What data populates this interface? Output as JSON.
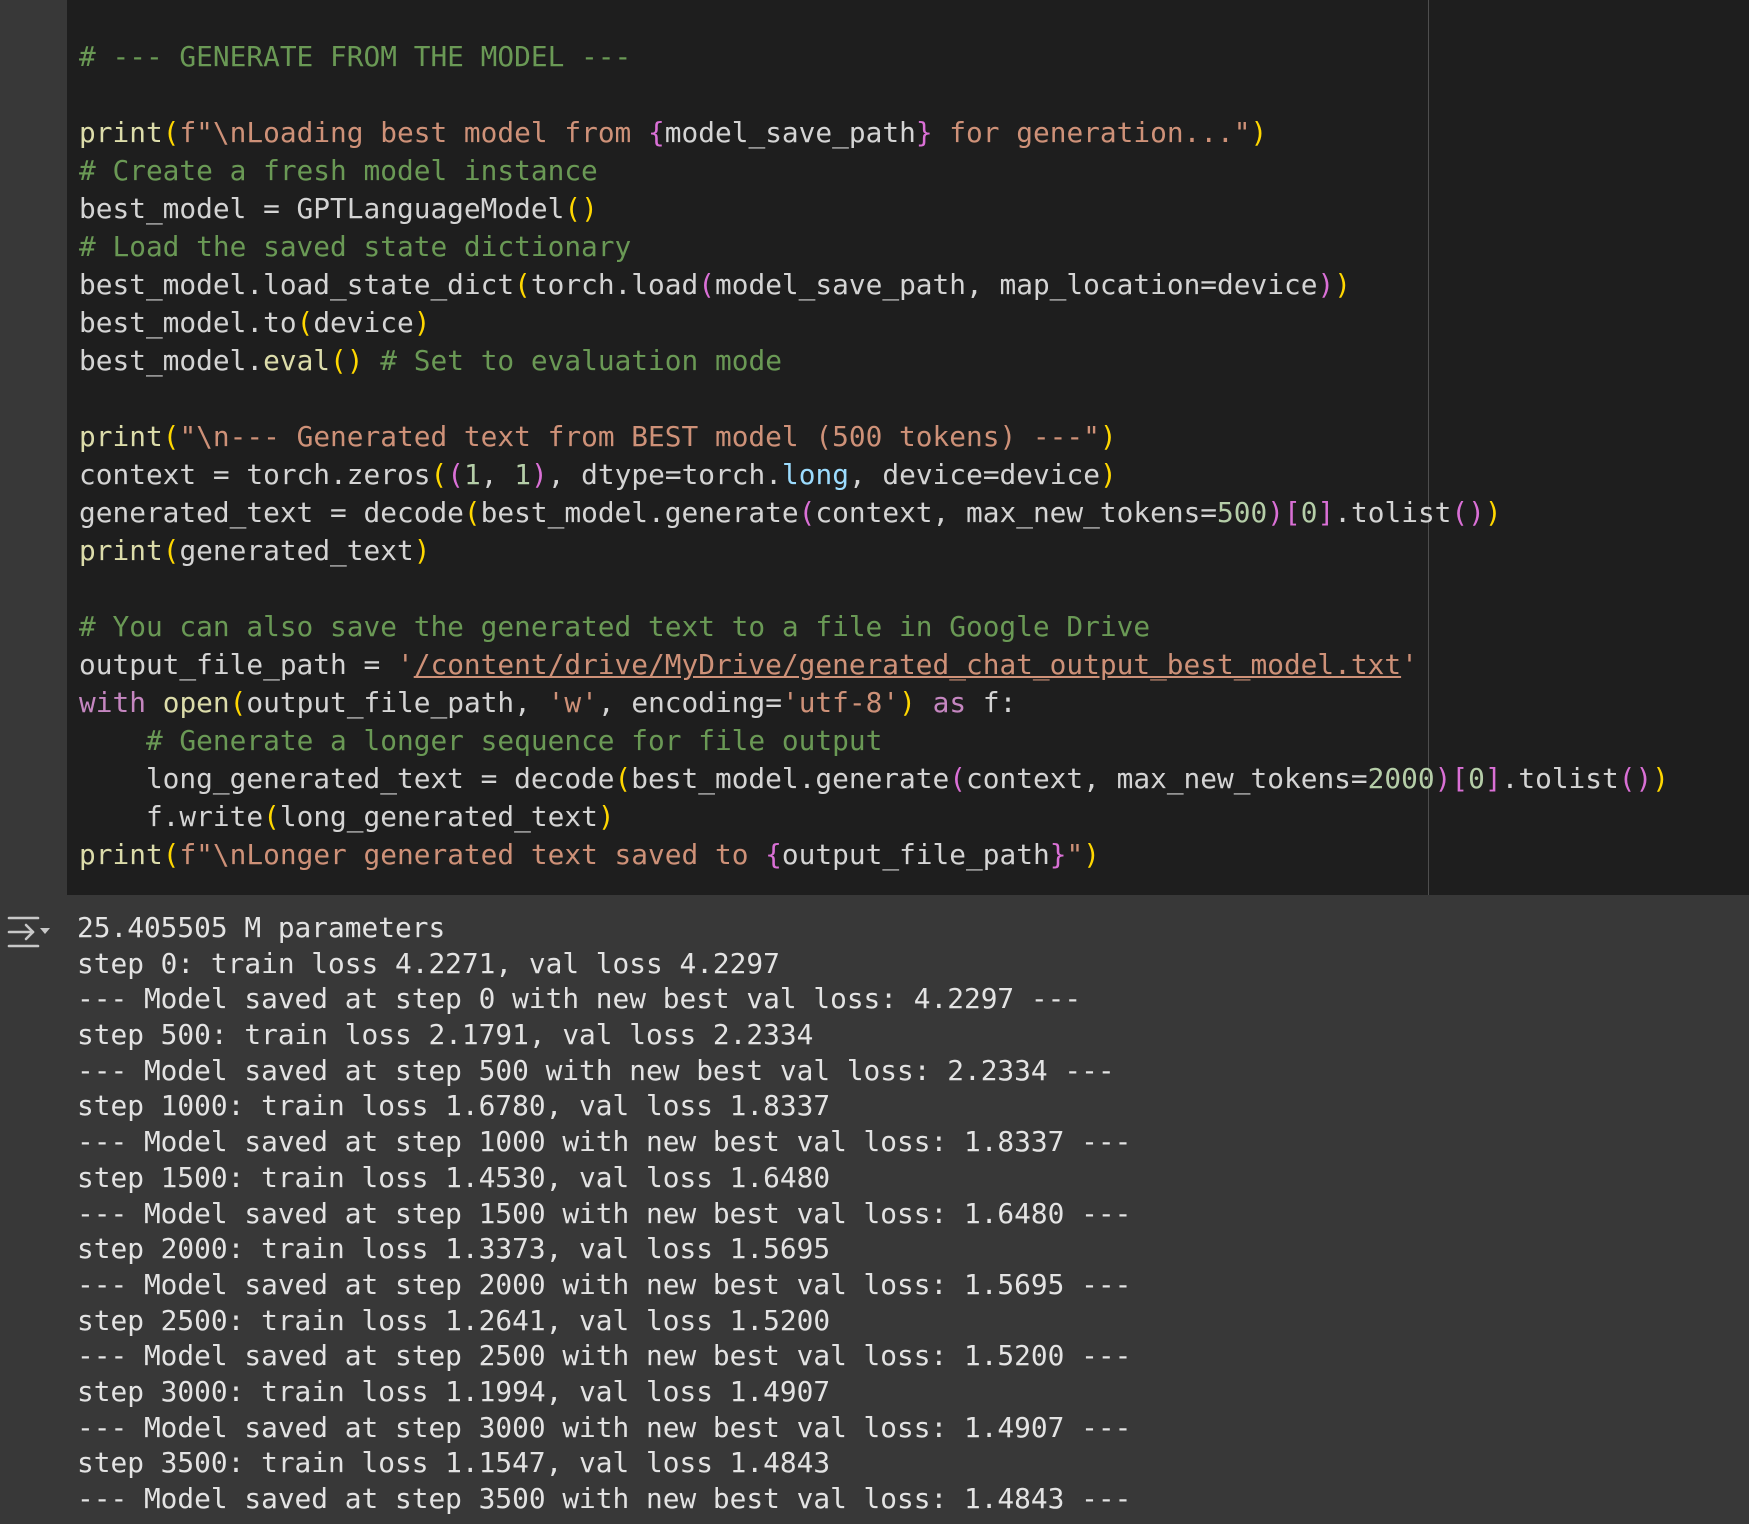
{
  "code_cell": {
    "lines": [
      [
        {
          "t": "# --- GENERATE FROM THE MODEL ---",
          "c": "cm"
        }
      ],
      [],
      [
        {
          "t": "print",
          "c": "fn"
        },
        {
          "t": "(",
          "c": "p1"
        },
        {
          "t": "f\"\\nLoading best model from ",
          "c": "st"
        },
        {
          "t": "{",
          "c": "p2"
        },
        {
          "t": "model_save_path"
        },
        {
          "t": "}",
          "c": "p2"
        },
        {
          "t": " for generation...\"",
          "c": "st"
        },
        {
          "t": ")",
          "c": "p1"
        }
      ],
      [
        {
          "t": "# Create a fresh model instance",
          "c": "cm"
        }
      ],
      [
        {
          "t": "best_model = GPTLanguageModel"
        },
        {
          "t": "()",
          "c": "p1"
        }
      ],
      [
        {
          "t": "# Load the saved state dictionary",
          "c": "cm"
        }
      ],
      [
        {
          "t": "best_model.load_state_dict"
        },
        {
          "t": "(",
          "c": "p1"
        },
        {
          "t": "torch.load"
        },
        {
          "t": "(",
          "c": "p2"
        },
        {
          "t": "model_save_path, map_location=device"
        },
        {
          "t": ")",
          "c": "p2"
        },
        {
          "t": ")",
          "c": "p1"
        }
      ],
      [
        {
          "t": "best_model.to"
        },
        {
          "t": "(",
          "c": "p1"
        },
        {
          "t": "device"
        },
        {
          "t": ")",
          "c": "p1"
        }
      ],
      [
        {
          "t": "best_model."
        },
        {
          "t": "eval",
          "c": "fn"
        },
        {
          "t": "()",
          "c": "p1"
        },
        {
          "t": " "
        },
        {
          "t": "# Set to evaluation mode",
          "c": "cm"
        }
      ],
      [],
      [
        {
          "t": "print",
          "c": "fn"
        },
        {
          "t": "(",
          "c": "p1"
        },
        {
          "t": "\"\\n--- Generated text from BEST model (500 tokens) ---\"",
          "c": "st"
        },
        {
          "t": ")",
          "c": "p1"
        }
      ],
      [
        {
          "t": "context = torch.zeros"
        },
        {
          "t": "(",
          "c": "p1"
        },
        {
          "t": "(",
          "c": "p2"
        },
        {
          "t": "1",
          "c": "nu"
        },
        {
          "t": ", "
        },
        {
          "t": "1",
          "c": "nu"
        },
        {
          "t": ")",
          "c": "p2"
        },
        {
          "t": ", dtype=torch."
        },
        {
          "t": "long",
          "c": "ty"
        },
        {
          "t": ", device=device"
        },
        {
          "t": ")",
          "c": "p1"
        }
      ],
      [
        {
          "t": "generated_text = decode"
        },
        {
          "t": "(",
          "c": "p1"
        },
        {
          "t": "best_model.generate"
        },
        {
          "t": "(",
          "c": "p2"
        },
        {
          "t": "context, max_new_tokens="
        },
        {
          "t": "500",
          "c": "nu"
        },
        {
          "t": ")",
          "c": "p2"
        },
        {
          "t": "[",
          "c": "p2"
        },
        {
          "t": "0",
          "c": "nu"
        },
        {
          "t": "]",
          "c": "p2"
        },
        {
          "t": ".tolist"
        },
        {
          "t": "()",
          "c": "p2"
        },
        {
          "t": ")",
          "c": "p1"
        }
      ],
      [
        {
          "t": "print",
          "c": "fn"
        },
        {
          "t": "(",
          "c": "p1"
        },
        {
          "t": "generated_text"
        },
        {
          "t": ")",
          "c": "p1"
        }
      ],
      [],
      [
        {
          "t": "# You can also save the generated text to a file in Google Drive",
          "c": "cm"
        }
      ],
      [
        {
          "t": "output_file_path = "
        },
        {
          "t": "'",
          "c": "st"
        },
        {
          "t": "/content/drive/MyDrive/generated_chat_output_best_model.txt",
          "c": "st ul"
        },
        {
          "t": "'",
          "c": "st"
        }
      ],
      [
        {
          "t": "with",
          "c": "kw"
        },
        {
          "t": " "
        },
        {
          "t": "open",
          "c": "fn"
        },
        {
          "t": "(",
          "c": "p1"
        },
        {
          "t": "output_file_path, "
        },
        {
          "t": "'w'",
          "c": "st"
        },
        {
          "t": ", encoding="
        },
        {
          "t": "'utf-8'",
          "c": "st"
        },
        {
          "t": ")",
          "c": "p1"
        },
        {
          "t": " "
        },
        {
          "t": "as",
          "c": "kw"
        },
        {
          "t": " f:"
        }
      ],
      [
        {
          "t": "    "
        },
        {
          "t": "# Generate a longer sequence for file output",
          "c": "cm"
        }
      ],
      [
        {
          "t": "    long_generated_text = decode"
        },
        {
          "t": "(",
          "c": "p1"
        },
        {
          "t": "best_model.generate"
        },
        {
          "t": "(",
          "c": "p2"
        },
        {
          "t": "context, max_new_tokens="
        },
        {
          "t": "2000",
          "c": "nu"
        },
        {
          "t": ")",
          "c": "p2"
        },
        {
          "t": "[",
          "c": "p2"
        },
        {
          "t": "0",
          "c": "nu"
        },
        {
          "t": "]",
          "c": "p2"
        },
        {
          "t": ".tolist"
        },
        {
          "t": "()",
          "c": "p2"
        },
        {
          "t": ")",
          "c": "p1"
        }
      ],
      [
        {
          "t": "    f.write"
        },
        {
          "t": "(",
          "c": "p1"
        },
        {
          "t": "long_generated_text"
        },
        {
          "t": ")",
          "c": "p1"
        }
      ],
      [
        {
          "t": "print",
          "c": "fn"
        },
        {
          "t": "(",
          "c": "p1"
        },
        {
          "t": "f\"\\nLonger generated text saved to ",
          "c": "st"
        },
        {
          "t": "{",
          "c": "p2"
        },
        {
          "t": "output_file_path"
        },
        {
          "t": "}",
          "c": "p2"
        },
        {
          "t": "\"",
          "c": "st"
        },
        {
          "t": ")",
          "c": "p1"
        }
      ]
    ]
  },
  "output": {
    "icon": "output-toggle-icon",
    "lines": [
      "25.405505 M parameters",
      "step 0: train loss 4.2271, val loss 4.2297",
      "--- Model saved at step 0 with new best val loss: 4.2297 ---",
      "step 500: train loss 2.1791, val loss 2.2334",
      "--- Model saved at step 500 with new best val loss: 2.2334 ---",
      "step 1000: train loss 1.6780, val loss 1.8337",
      "--- Model saved at step 1000 with new best val loss: 1.8337 ---",
      "step 1500: train loss 1.4530, val loss 1.6480",
      "--- Model saved at step 1500 with new best val loss: 1.6480 ---",
      "step 2000: train loss 1.3373, val loss 1.5695",
      "--- Model saved at step 2000 with new best val loss: 1.5695 ---",
      "step 2500: train loss 1.2641, val loss 1.5200",
      "--- Model saved at step 2500 with new best val loss: 1.5200 ---",
      "step 3000: train loss 1.1994, val loss 1.4907",
      "--- Model saved at step 3000 with new best val loss: 1.4907 ---",
      "step 3500: train loss 1.1547, val loss 1.4843",
      "--- Model saved at step 3500 with new best val loss: 1.4843 ---"
    ]
  }
}
